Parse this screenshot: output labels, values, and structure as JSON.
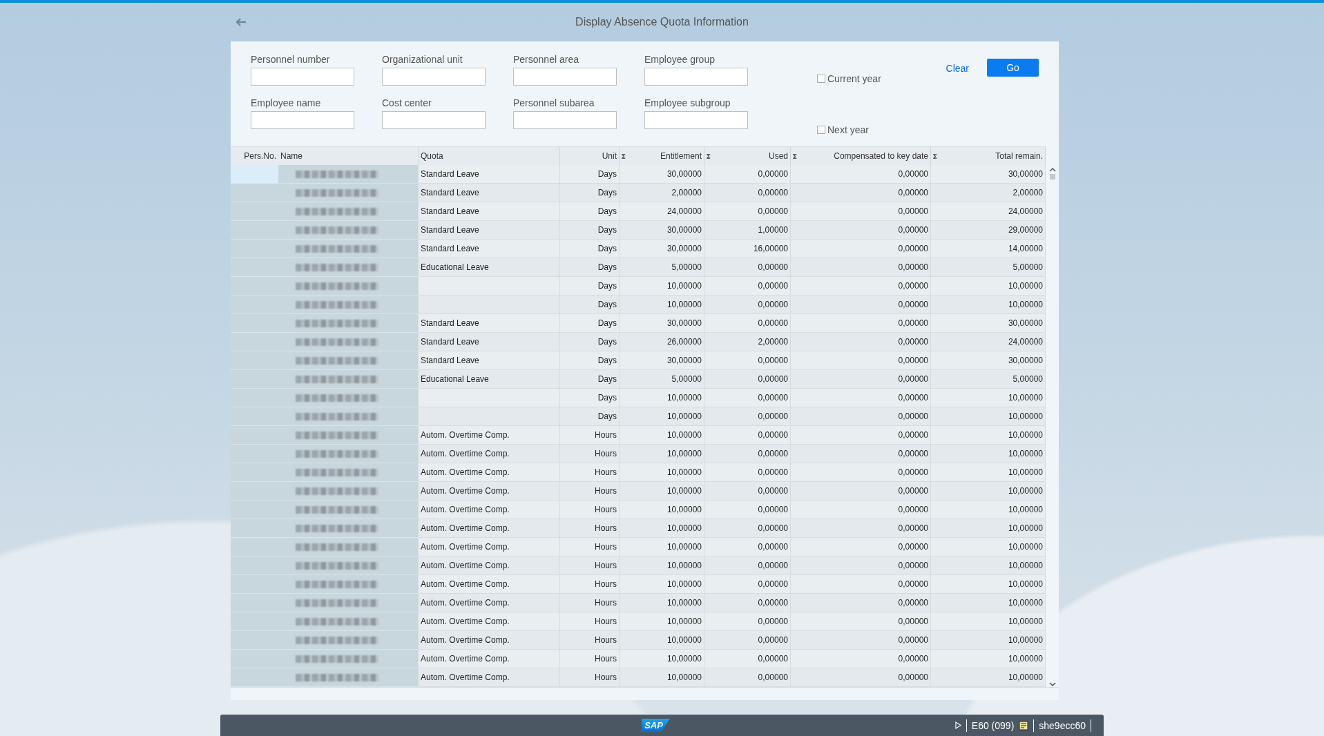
{
  "header": {
    "title": "Display Absence Quota Information"
  },
  "filters": {
    "fields": [
      {
        "label": "Personnel number"
      },
      {
        "label": "Organizational unit"
      },
      {
        "label": "Personnel area"
      },
      {
        "label": "Employee group"
      },
      {
        "label": "Employee name"
      },
      {
        "label": "Cost center"
      },
      {
        "label": "Personnel subarea"
      },
      {
        "label": "Employee subgroup"
      }
    ],
    "checkboxes": [
      {
        "label": "Current year",
        "checked": false
      },
      {
        "label": "Next year",
        "checked": false
      }
    ],
    "clear": "Clear",
    "go": "Go"
  },
  "table": {
    "columns": [
      {
        "label": "Pers.No.",
        "sum": false
      },
      {
        "label": "Name",
        "sum": false
      },
      {
        "label": "Quota",
        "sum": false
      },
      {
        "label": "Unit",
        "sum": false
      },
      {
        "label": "Entitlement",
        "sum": true
      },
      {
        "label": "Used",
        "sum": true
      },
      {
        "label": "Compensated to key date",
        "sum": true
      },
      {
        "label": "Total remain.",
        "sum": true
      }
    ],
    "rows": [
      {
        "selected": true,
        "quota": "Standard Leave",
        "unit": "Days",
        "entitlement": "30,00000",
        "used": "0,00000",
        "compensated": "0,00000",
        "total": "30,00000"
      },
      {
        "selected": false,
        "quota": "Standard Leave",
        "unit": "Days",
        "entitlement": "2,00000",
        "used": "0,00000",
        "compensated": "0,00000",
        "total": "2,00000"
      },
      {
        "selected": false,
        "quota": "Standard Leave",
        "unit": "Days",
        "entitlement": "24,00000",
        "used": "0,00000",
        "compensated": "0,00000",
        "total": "24,00000"
      },
      {
        "selected": false,
        "quota": "Standard Leave",
        "unit": "Days",
        "entitlement": "30,00000",
        "used": "1,00000",
        "compensated": "0,00000",
        "total": "29,00000"
      },
      {
        "selected": false,
        "quota": "Standard Leave",
        "unit": "Days",
        "entitlement": "30,00000",
        "used": "16,00000",
        "compensated": "0,00000",
        "total": "14,00000"
      },
      {
        "selected": false,
        "quota": "Educational Leave",
        "unit": "Days",
        "entitlement": "5,00000",
        "used": "0,00000",
        "compensated": "0,00000",
        "total": "5,00000"
      },
      {
        "selected": false,
        "unit": "Days",
        "entitlement": "10,00000",
        "used": "0,00000",
        "compensated": "0,00000",
        "total": "10,00000"
      },
      {
        "selected": false,
        "unit": "Days",
        "entitlement": "10,00000",
        "used": "0,00000",
        "compensated": "0,00000",
        "total": "10,00000"
      },
      {
        "selected": false,
        "quota": "Standard Leave",
        "unit": "Days",
        "entitlement": "30,00000",
        "used": "0,00000",
        "compensated": "0,00000",
        "total": "30,00000"
      },
      {
        "selected": false,
        "quota": "Standard Leave",
        "unit": "Days",
        "entitlement": "26,00000",
        "used": "2,00000",
        "compensated": "0,00000",
        "total": "24,00000"
      },
      {
        "selected": false,
        "quota": "Standard Leave",
        "unit": "Days",
        "entitlement": "30,00000",
        "used": "0,00000",
        "compensated": "0,00000",
        "total": "30,00000"
      },
      {
        "selected": false,
        "quota": "Educational Leave",
        "unit": "Days",
        "entitlement": "5,00000",
        "used": "0,00000",
        "compensated": "0,00000",
        "total": "5,00000"
      },
      {
        "selected": false,
        "unit": "Days",
        "entitlement": "10,00000",
        "used": "0,00000",
        "compensated": "0,00000",
        "total": "10,00000"
      },
      {
        "selected": false,
        "unit": "Days",
        "entitlement": "10,00000",
        "used": "0,00000",
        "compensated": "0,00000",
        "total": "10,00000"
      },
      {
        "selected": false,
        "quota": "Autom. Overtime Comp.",
        "unit": "Hours",
        "entitlement": "10,00000",
        "used": "0,00000",
        "compensated": "0,00000",
        "total": "10,00000"
      },
      {
        "selected": false,
        "quota": "Autom. Overtime Comp.",
        "unit": "Hours",
        "entitlement": "10,00000",
        "used": "0,00000",
        "compensated": "0,00000",
        "total": "10,00000"
      },
      {
        "selected": false,
        "quota": "Autom. Overtime Comp.",
        "unit": "Hours",
        "entitlement": "10,00000",
        "used": "0,00000",
        "compensated": "0,00000",
        "total": "10,00000"
      },
      {
        "selected": false,
        "quota": "Autom. Overtime Comp.",
        "unit": "Hours",
        "entitlement": "10,00000",
        "used": "0,00000",
        "compensated": "0,00000",
        "total": "10,00000"
      },
      {
        "selected": false,
        "quota": "Autom. Overtime Comp.",
        "unit": "Hours",
        "entitlement": "10,00000",
        "used": "0,00000",
        "compensated": "0,00000",
        "total": "10,00000"
      },
      {
        "selected": false,
        "quota": "Autom. Overtime Comp.",
        "unit": "Hours",
        "entitlement": "10,00000",
        "used": "0,00000",
        "compensated": "0,00000",
        "total": "10,00000"
      },
      {
        "selected": false,
        "quota": "Autom. Overtime Comp.",
        "unit": "Hours",
        "entitlement": "10,00000",
        "used": "0,00000",
        "compensated": "0,00000",
        "total": "10,00000"
      },
      {
        "selected": false,
        "quota": "Autom. Overtime Comp.",
        "unit": "Hours",
        "entitlement": "10,00000",
        "used": "0,00000",
        "compensated": "0,00000",
        "total": "10,00000"
      },
      {
        "selected": false,
        "quota": "Autom. Overtime Comp.",
        "unit": "Hours",
        "entitlement": "10,00000",
        "used": "0,00000",
        "compensated": "0,00000",
        "total": "10,00000"
      },
      {
        "selected": false,
        "quota": "Autom. Overtime Comp.",
        "unit": "Hours",
        "entitlement": "10,00000",
        "used": "0,00000",
        "compensated": "0,00000",
        "total": "10,00000"
      },
      {
        "selected": false,
        "quota": "Autom. Overtime Comp.",
        "unit": "Hours",
        "entitlement": "10,00000",
        "used": "0,00000",
        "compensated": "0,00000",
        "total": "10,00000"
      },
      {
        "selected": false,
        "quota": "Autom. Overtime Comp.",
        "unit": "Hours",
        "entitlement": "10,00000",
        "used": "0,00000",
        "compensated": "0,00000",
        "total": "10,00000"
      },
      {
        "selected": false,
        "quota": "Autom. Overtime Comp.",
        "unit": "Hours",
        "entitlement": "10,00000",
        "used": "0,00000",
        "compensated": "0,00000",
        "total": "10,00000"
      },
      {
        "selected": false,
        "quota": "Autom. Overtime Comp.",
        "unit": "Hours",
        "entitlement": "10,00000",
        "used": "0,00000",
        "compensated": "0,00000",
        "total": "10,00000"
      }
    ]
  },
  "status_bar": {
    "logo": "SAP",
    "system": "E60 (099)",
    "server": "she9ecc60"
  }
}
